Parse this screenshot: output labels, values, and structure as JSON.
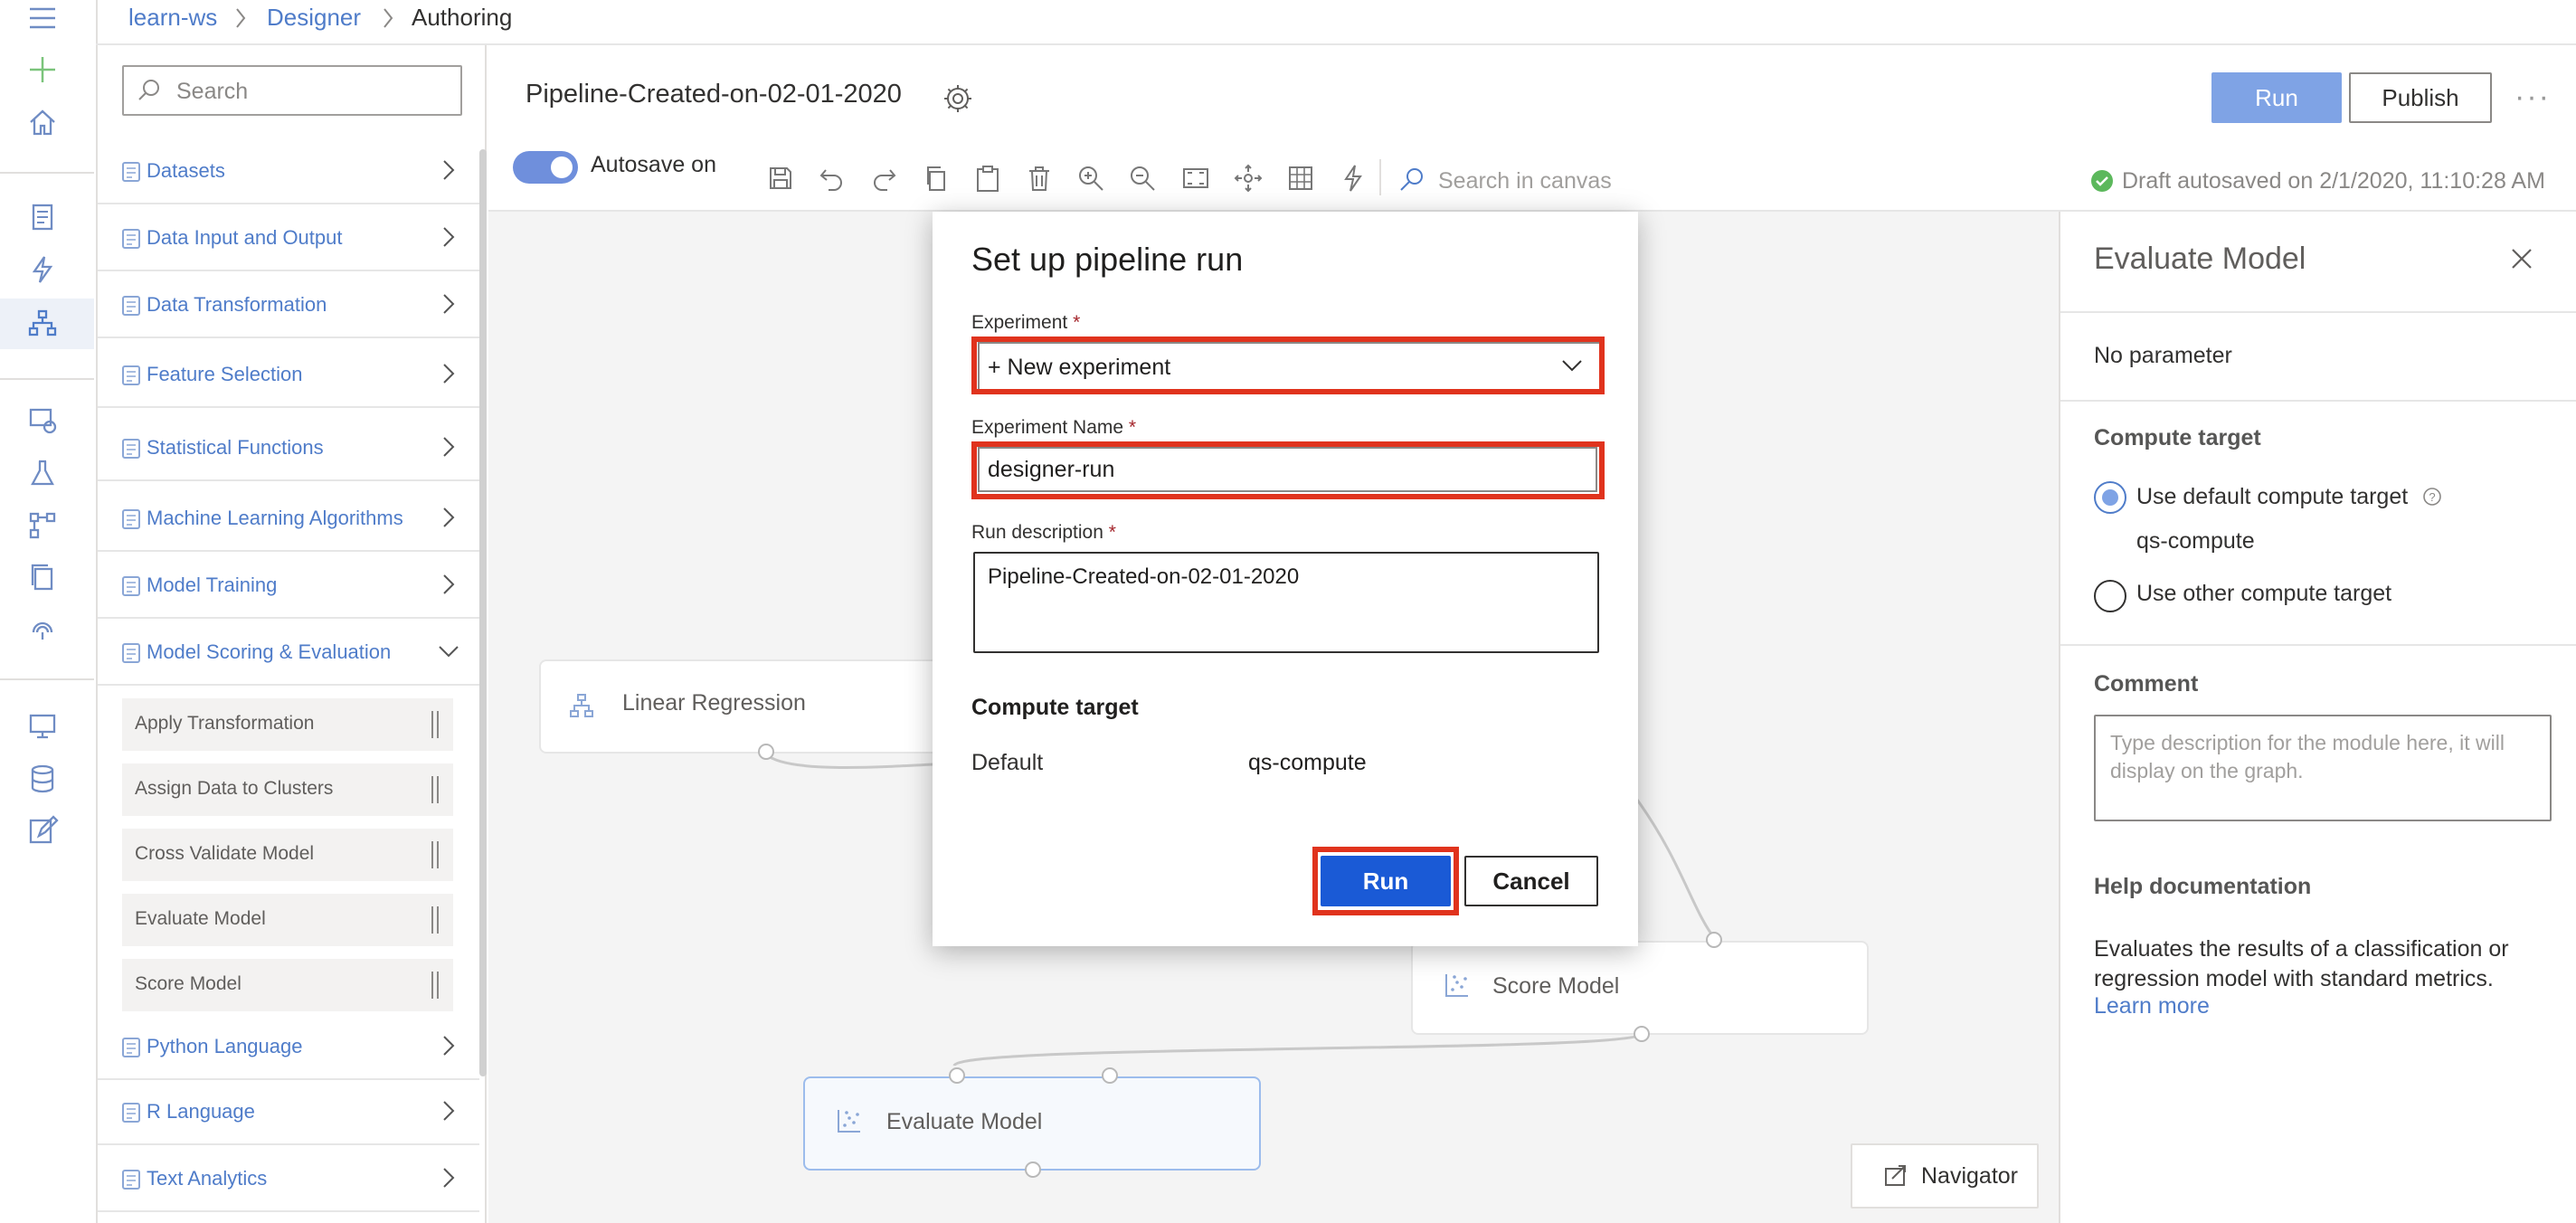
{
  "breadcrumb": {
    "workspace": "learn-ws",
    "section": "Designer",
    "current": "Authoring"
  },
  "palette": {
    "search_placeholder": "Search",
    "categories": [
      {
        "label": "Datasets",
        "icon": "cylinder-icon"
      },
      {
        "label": "Data Input and Output",
        "icon": "data-io-icon"
      },
      {
        "label": "Data Transformation",
        "icon": "transform-icon"
      },
      {
        "label": "Feature Selection",
        "icon": "list-icon"
      },
      {
        "label": "Statistical Functions",
        "icon": "bar-chart-icon"
      },
      {
        "label": "Machine Learning Algorithms",
        "icon": "tree-icon"
      },
      {
        "label": "Model Training",
        "icon": "training-icon"
      },
      {
        "label": "Model Scoring & Evaluation",
        "icon": "scatter-icon"
      },
      {
        "label": "Python Language",
        "icon": "python-icon"
      },
      {
        "label": "R Language",
        "icon": "r-icon"
      },
      {
        "label": "Text Analytics",
        "icon": "text-icon"
      }
    ],
    "scoring_modules": [
      "Apply Transformation",
      "Assign Data to Clusters",
      "Cross Validate Model",
      "Evaluate Model",
      "Score Model"
    ]
  },
  "header": {
    "pipeline_title": "Pipeline-Created-on-02-01-2020",
    "run_label": "Run",
    "publish_label": "Publish",
    "more_label": "···"
  },
  "toolbar": {
    "autosave_label": "Autosave on",
    "canvas_search_placeholder": "Search in canvas",
    "draft_status": "Draft autosaved on 2/1/2020, 11:10:28 AM"
  },
  "canvas": {
    "nodes": [
      "Linear Regression",
      "Score Model",
      "Evaluate Model"
    ],
    "navigator_label": "Navigator"
  },
  "dialog": {
    "title": "Set up pipeline run",
    "experiment_label": "Experiment",
    "experiment_value": "+ New experiment",
    "experiment_name_label": "Experiment Name",
    "experiment_name_value": "designer-run",
    "run_description_label": "Run description",
    "run_description_value": "Pipeline-Created-on-02-01-2020",
    "required_mark": "*",
    "compute_target_heading": "Compute target",
    "compute_default_label": "Default",
    "compute_default_value": "qs-compute",
    "run_label": "Run",
    "cancel_label": "Cancel"
  },
  "right_panel": {
    "title": "Evaluate Model",
    "no_parameter": "No parameter",
    "compute_target_heading": "Compute target",
    "use_default_label": "Use default compute target",
    "default_compute_name": "qs-compute",
    "use_other_label": "Use other compute target",
    "comment_heading": "Comment",
    "comment_placeholder": "Type description for the module here, it will display on the graph.",
    "help_heading": "Help documentation",
    "help_text": "Evaluates the results of a classification or regression model with standard metrics.",
    "learn_more": "Learn more"
  },
  "colors": {
    "accent": "#1a5ad6",
    "accent_light": "#7fa3e5",
    "highlight_border": "#e0331d",
    "link": "#4f7cc9",
    "success": "#5cb85c"
  }
}
